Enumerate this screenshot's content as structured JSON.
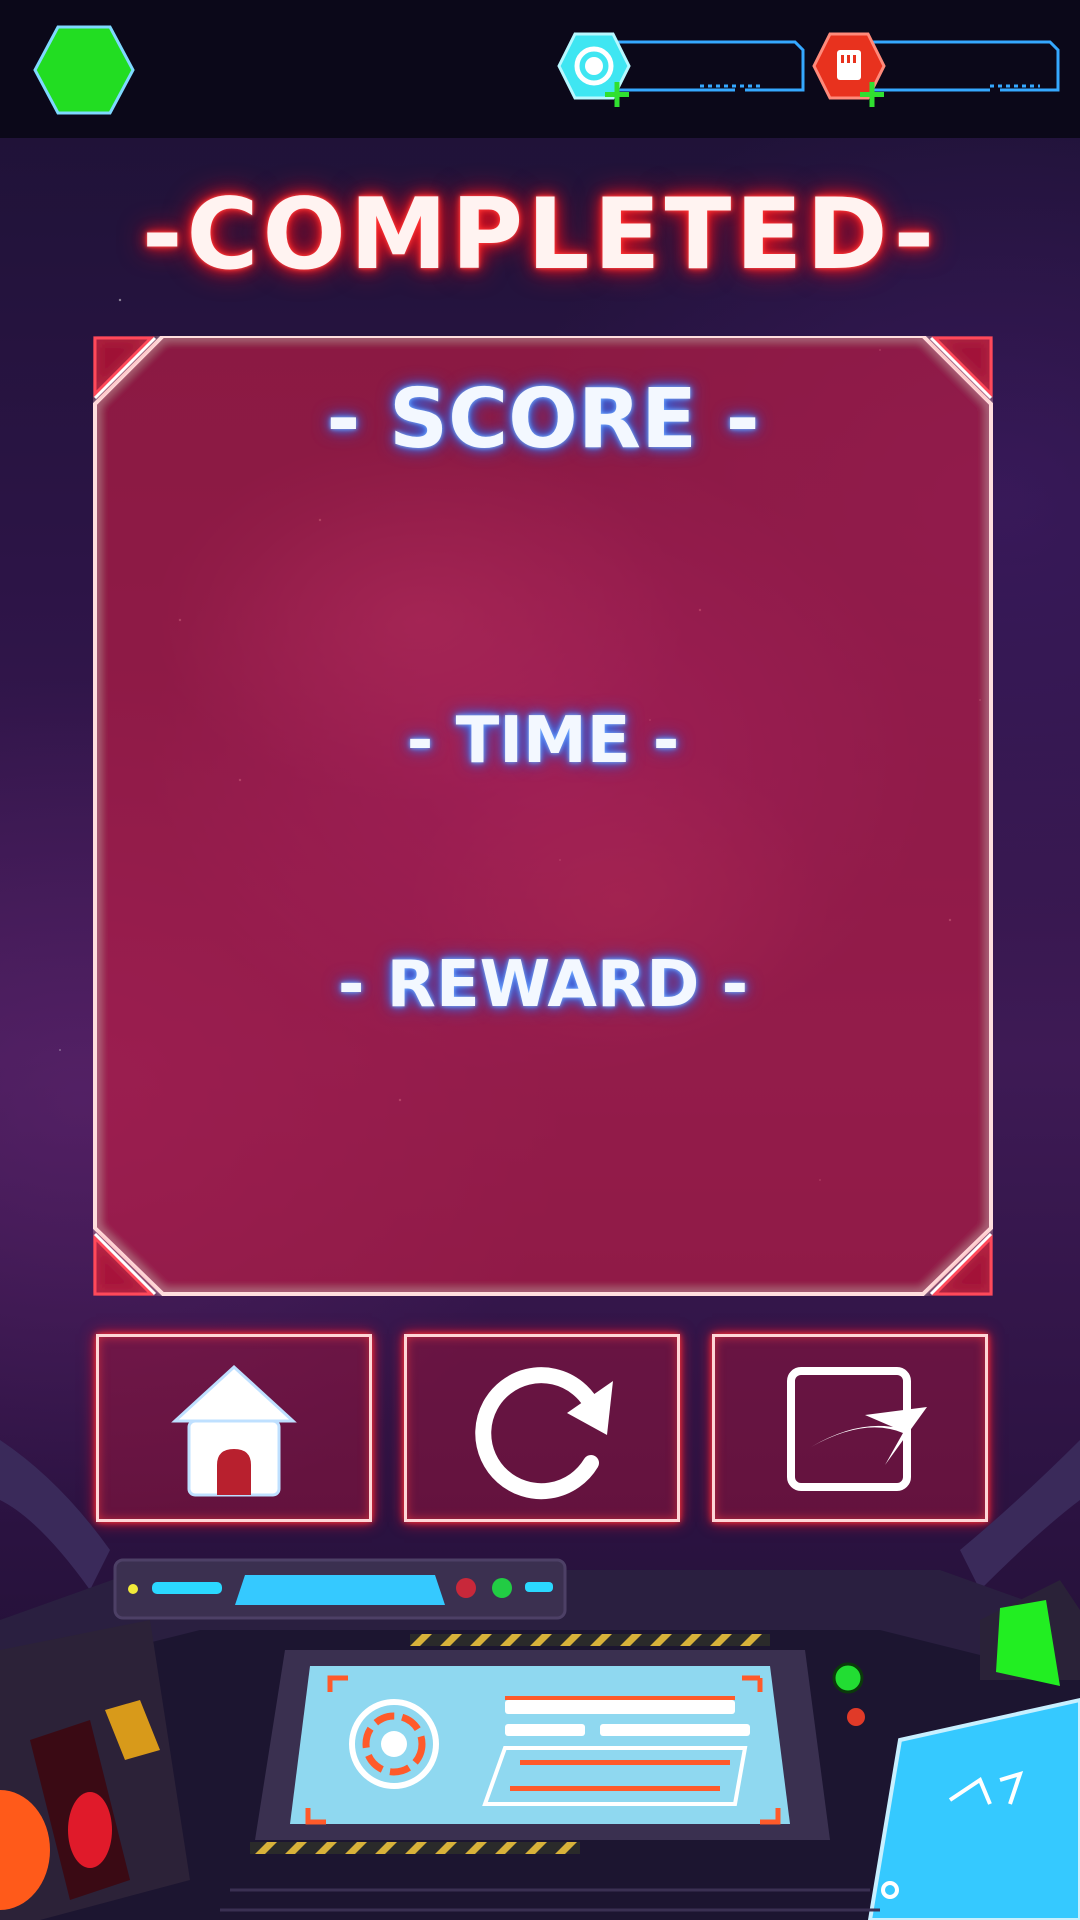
{
  "title": "-COMPLETED-",
  "panel": {
    "score_label": "- SCORE -",
    "time_label": "- TIME -",
    "reward_label": "- REWARD -"
  },
  "topbar": {
    "level_badge_color": "#22dd22",
    "resources": [
      {
        "name": "coins",
        "icon": "coin-icon",
        "color": "#3fe6f2",
        "add_icon": "plus-icon"
      },
      {
        "name": "cards",
        "icon": "card-icon",
        "color": "#e8321e",
        "add_icon": "plus-icon"
      }
    ]
  },
  "buttons": [
    {
      "name": "home-button",
      "icon": "home-icon"
    },
    {
      "name": "replay-button",
      "icon": "replay-icon"
    },
    {
      "name": "next-button",
      "icon": "share-arrow-icon"
    }
  ],
  "colors": {
    "neon_red": "#ff2a3a",
    "neon_blue": "#3f7fff",
    "accent_cyan": "#35c9ff"
  }
}
